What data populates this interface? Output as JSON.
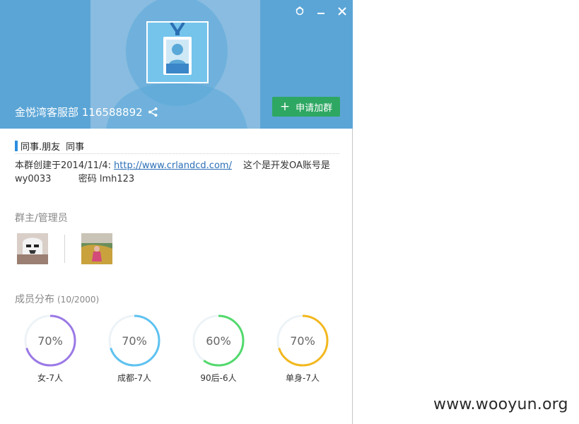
{
  "window": {
    "controls": [
      "settings",
      "minimize",
      "close"
    ]
  },
  "group": {
    "name_id": "金悦湾客服部 116588892",
    "join_label": "申请加群"
  },
  "tags": [
    "同事.朋友",
    "同事"
  ],
  "description": {
    "prefix": "本群创建于2014/11/4:",
    "link": "http://www.crlandcd.com/",
    "suffix": "这个是开发OA账号是",
    "line2_account": "wy0033",
    "line2_pw_label": "密码",
    "line2_pw": "lmh123"
  },
  "admins": {
    "label": "群主/管理员",
    "count": 2
  },
  "members": {
    "label": "成员分布",
    "count": "(10/2000)",
    "stats": [
      {
        "percent": "70%",
        "caption": "女-7人",
        "fraction": 0.7,
        "color": "#9b79e6"
      },
      {
        "percent": "70%",
        "caption": "成都-7人",
        "fraction": 0.7,
        "color": "#5ec2f0"
      },
      {
        "percent": "60%",
        "caption": "90后-6人",
        "fraction": 0.6,
        "color": "#52d96c"
      },
      {
        "percent": "70%",
        "caption": "单身-7人",
        "fraction": 0.7,
        "color": "#f2b81e"
      }
    ]
  },
  "watermark": "www.wooyun.org",
  "colors": {
    "banner": "#5ba5d6",
    "join_button": "#2ea763",
    "tag_bar": "#2b8ee0",
    "link": "#2b6fb7"
  }
}
